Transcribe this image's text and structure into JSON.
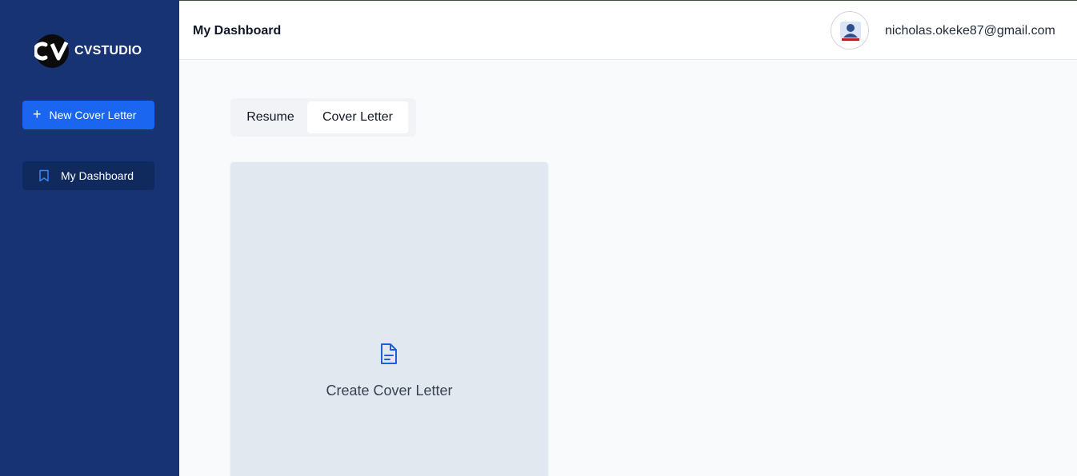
{
  "sidebar": {
    "logo": {
      "mark": "CV",
      "text": "CVSTUDIO"
    },
    "new_button": {
      "label": "New Cover Letter",
      "icon": "plus-icon"
    },
    "nav": [
      {
        "label": "My Dashboard",
        "icon": "bookmark-icon",
        "active": true
      }
    ]
  },
  "header": {
    "title": "My Dashboard",
    "user_email": "nicholas.okeke87@gmail.com",
    "avatar_icon": "avatar-image"
  },
  "tabs": [
    {
      "label": "Resume",
      "active": false
    },
    {
      "label": "Cover Letter",
      "active": true
    }
  ],
  "create_card": {
    "label": "Create Cover Letter",
    "icon": "document-icon"
  },
  "colors": {
    "sidebar_bg": "#173373",
    "primary": "#1a66f0",
    "nav_active_bg": "#112a5e",
    "card_bg": "#e2e8f0",
    "page_bg": "#f8fafc"
  }
}
